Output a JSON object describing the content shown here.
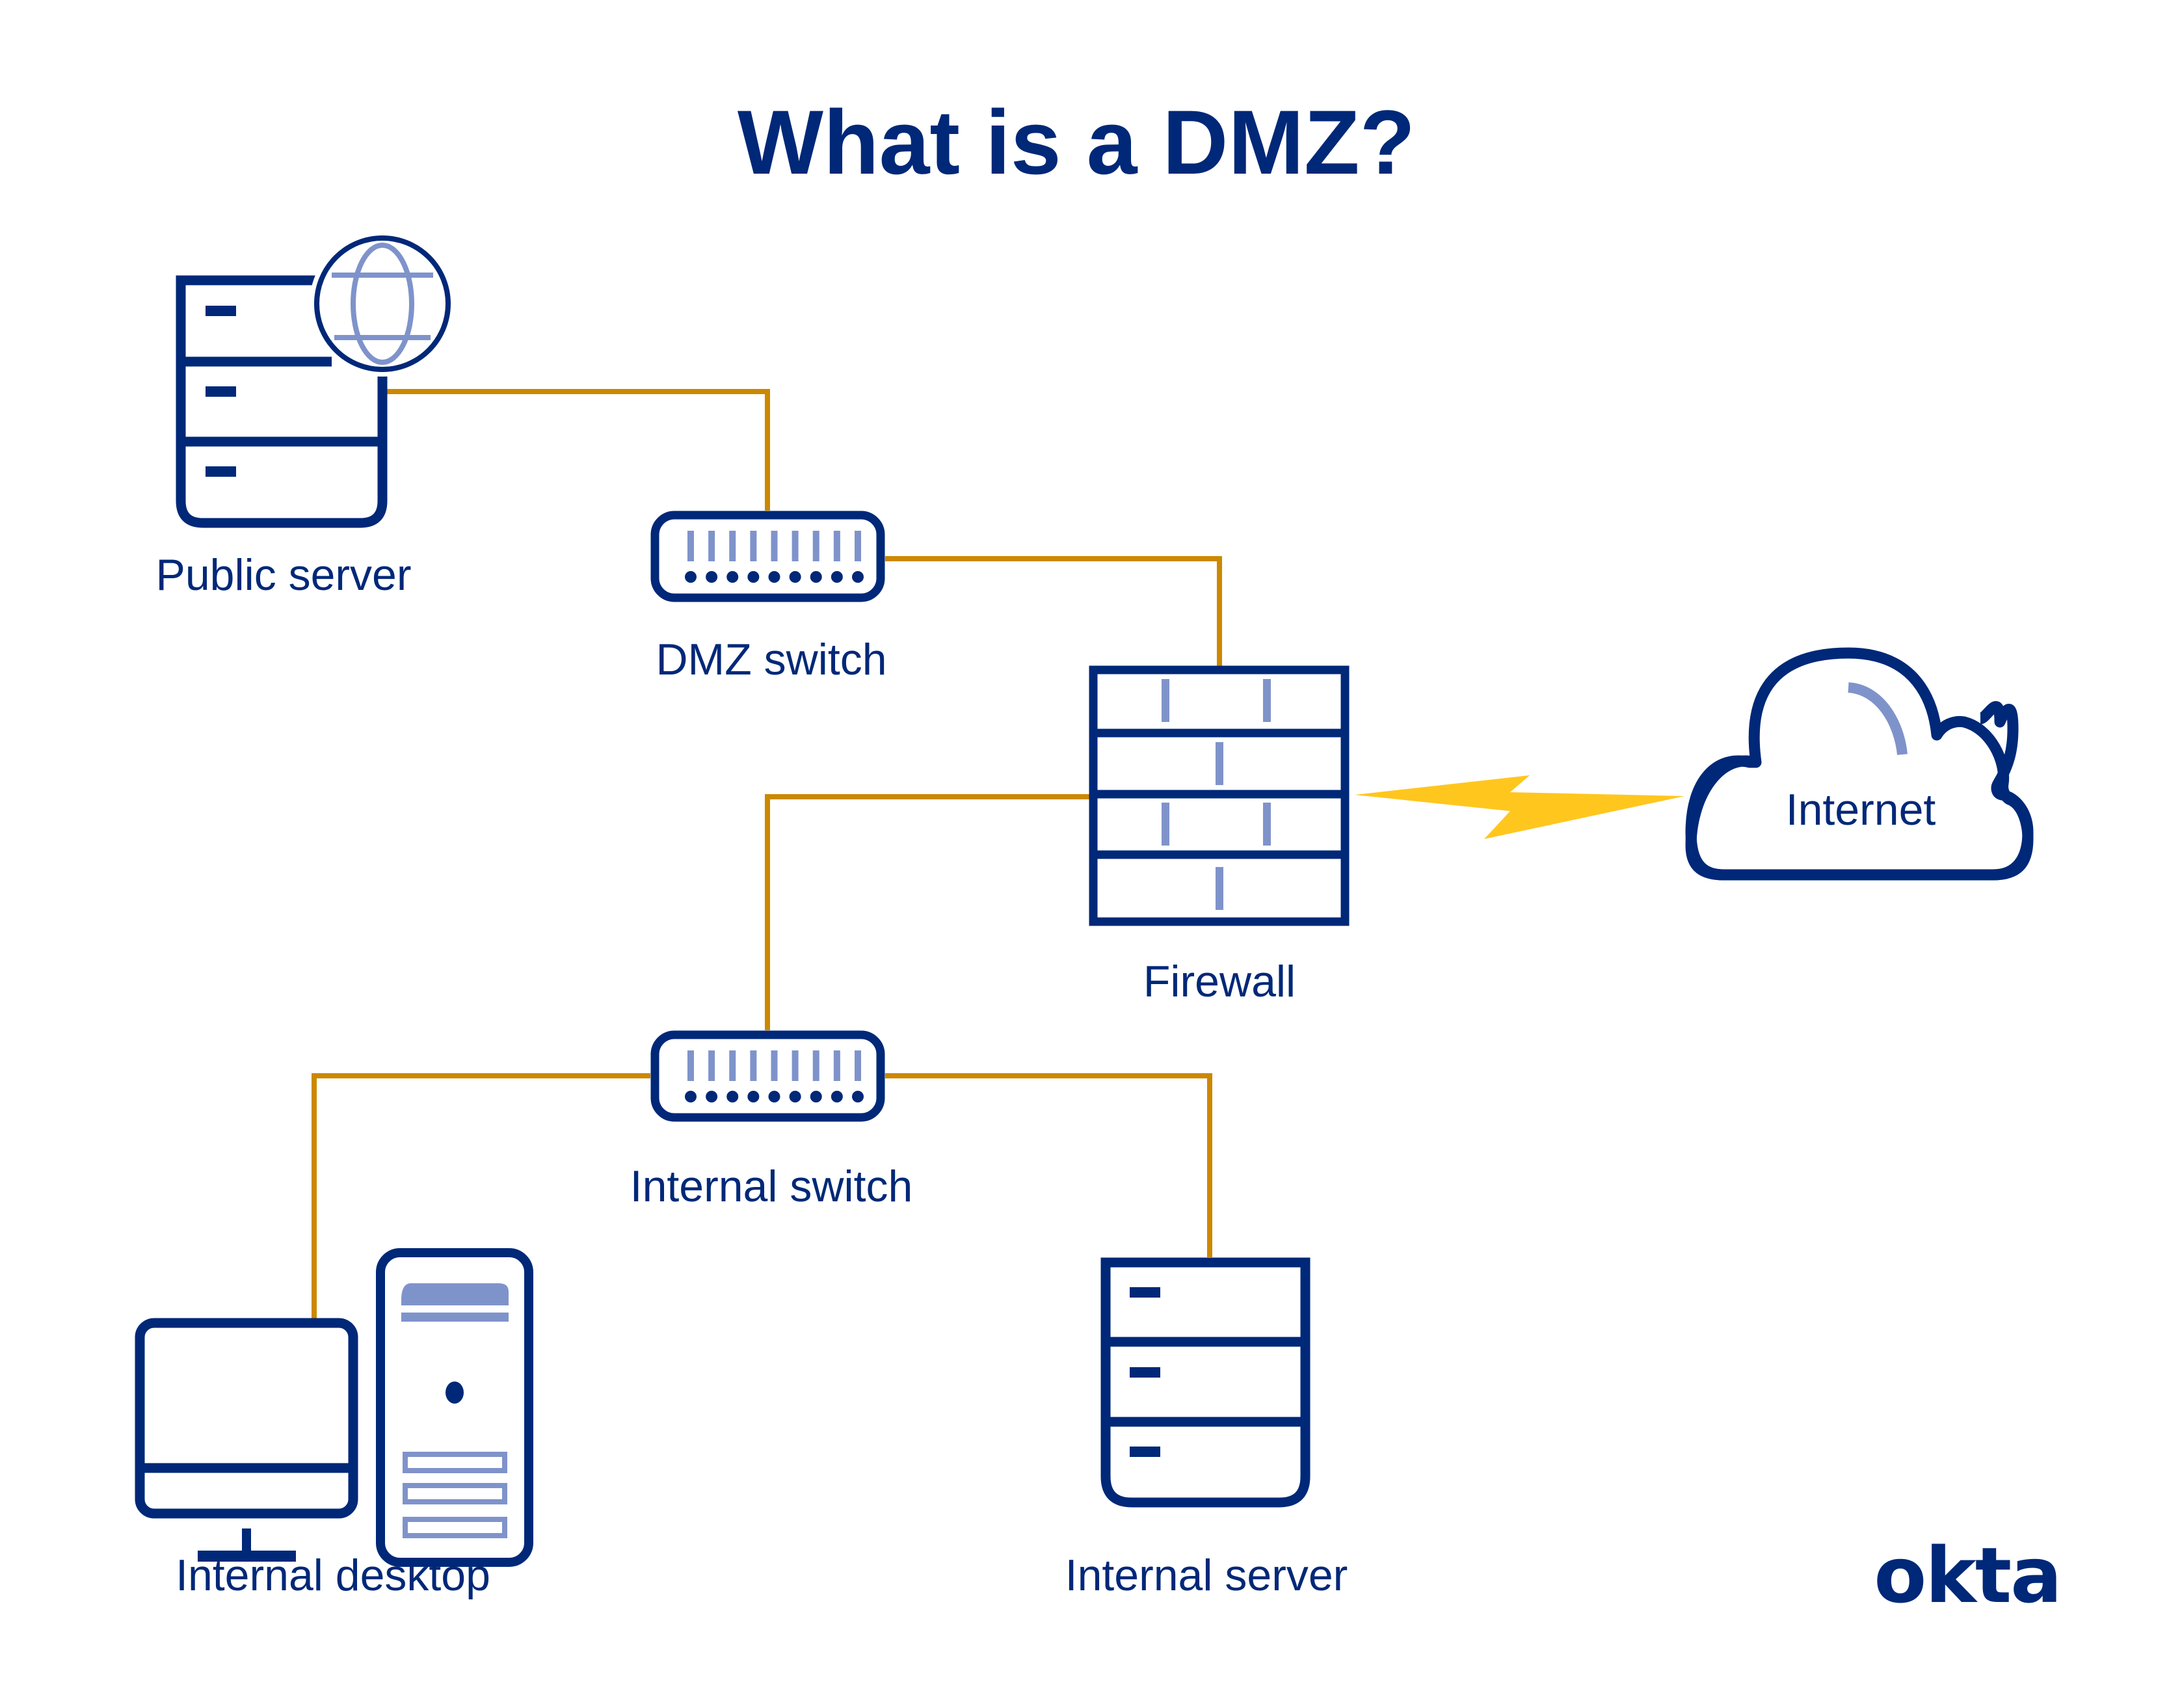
{
  "title": "What is a DMZ?",
  "colors": {
    "primary": "#002878",
    "accent_light": "#7F93CB",
    "connector": "#CC8800",
    "lightning": "#FFC61E",
    "background": "#FFFFFF"
  },
  "nodes": {
    "public_server": {
      "label": "Public server",
      "icon": "server-globe-icon"
    },
    "dmz_switch": {
      "label": "DMZ switch",
      "icon": "network-switch-icon"
    },
    "firewall": {
      "label": "Firewall",
      "icon": "firewall-brick-icon"
    },
    "internet": {
      "label": "Internet",
      "icon": "cloud-icon"
    },
    "internal_switch": {
      "label": "Internal switch",
      "icon": "network-switch-icon"
    },
    "internal_desktop": {
      "label": "Internal desktop",
      "icon": "desktop-computer-icon"
    },
    "internal_server": {
      "label": "Internal server",
      "icon": "server-icon"
    }
  },
  "connections": [
    {
      "from": "Public server",
      "to": "DMZ switch",
      "type": "wired"
    },
    {
      "from": "DMZ switch",
      "to": "Firewall",
      "type": "wired"
    },
    {
      "from": "Firewall",
      "to": "Internal switch",
      "type": "wired"
    },
    {
      "from": "Firewall",
      "to": "Internet",
      "type": "wireless-lightning"
    },
    {
      "from": "Internal switch",
      "to": "Internal desktop",
      "type": "wired"
    },
    {
      "from": "Internal switch",
      "to": "Internal server",
      "type": "wired"
    }
  ],
  "switch_ports": 9,
  "brand": {
    "logo_text": "okta"
  }
}
